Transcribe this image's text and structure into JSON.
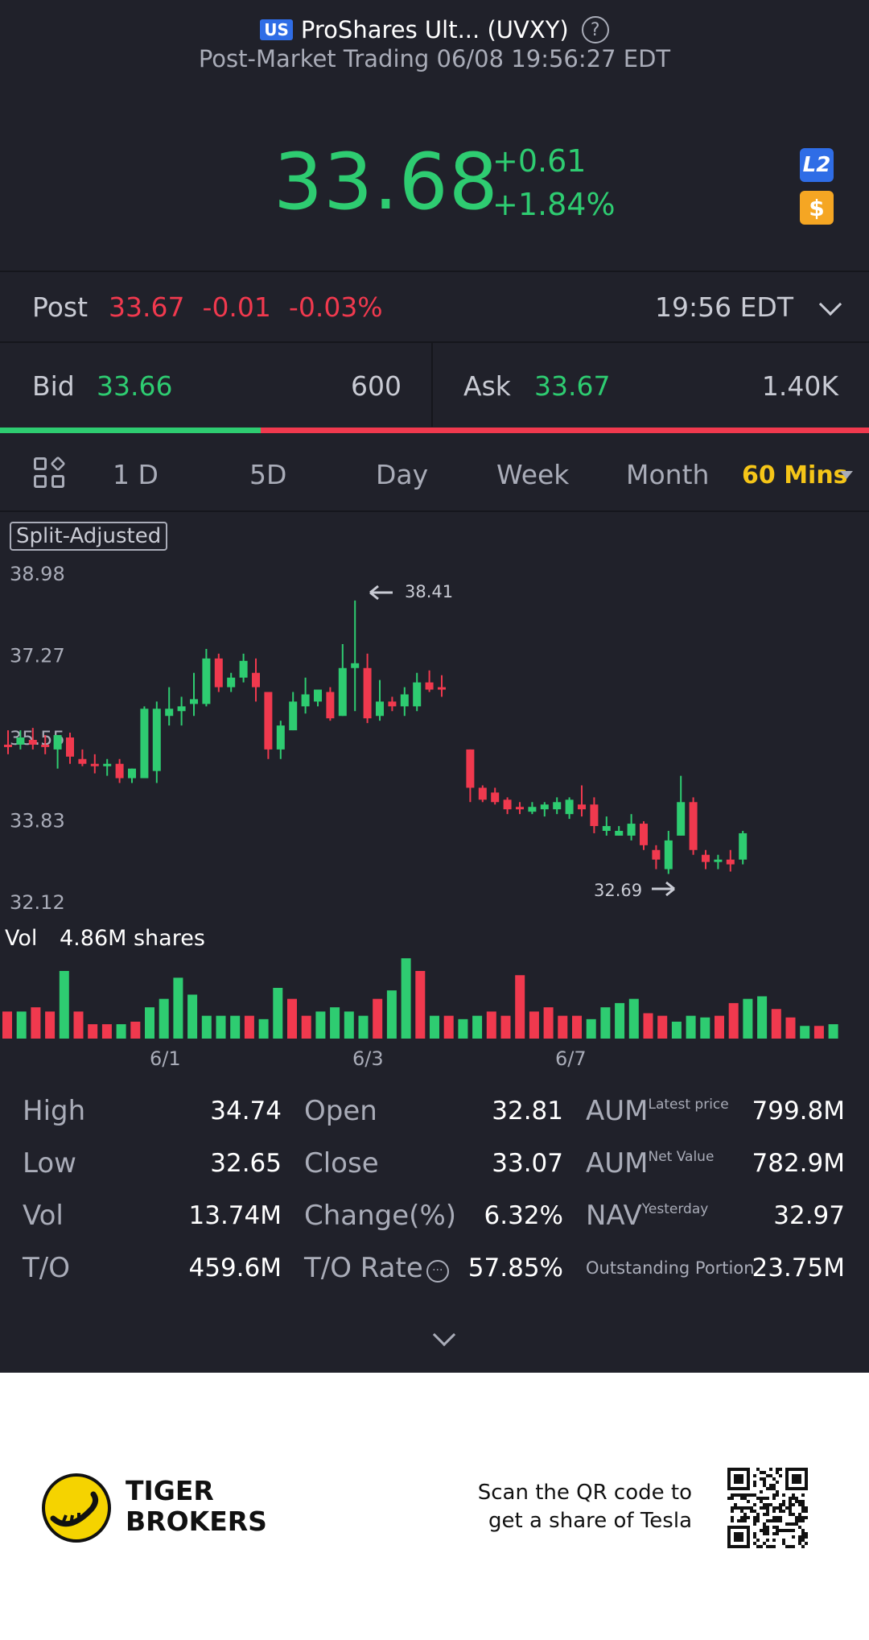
{
  "header": {
    "market_badge": "US",
    "title": "ProShares Ult... (UVXY)",
    "subtitle": "Post-Market Trading 06/08 19:56:27 EDT"
  },
  "quote": {
    "price": "33.68",
    "change": "+0.61",
    "change_pct": "+1.84%",
    "l2_icon": "L2",
    "dollar_icon": "$"
  },
  "post": {
    "label": "Post",
    "price": "33.67",
    "change": "-0.01",
    "change_pct": "-0.03%",
    "time": "19:56 EDT"
  },
  "bid_ask": {
    "bid_label": "Bid",
    "bid_price": "33.66",
    "bid_size": "600",
    "ask_label": "Ask",
    "ask_price": "33.67",
    "ask_size": "1.40K",
    "bid_share": 0.3
  },
  "tabs": [
    {
      "label": "1 D"
    },
    {
      "label": "5D"
    },
    {
      "label": "Day"
    },
    {
      "label": "Week"
    },
    {
      "label": "Month"
    },
    {
      "label": "60 Mins",
      "active": true
    }
  ],
  "chart": {
    "badge": "Split-Adjusted",
    "y_ticks": [
      "38.98",
      "37.27",
      "35.55",
      "33.83",
      "32.12"
    ],
    "max_marker": "38.41",
    "min_marker": "32.69",
    "vol_label": "Vol",
    "vol_value": "4.86M shares",
    "x_ticks": [
      "6/1",
      "6/3",
      "6/7"
    ]
  },
  "chart_data": {
    "type": "candlestick",
    "ylim": [
      32.12,
      38.98
    ],
    "x_ticks": [
      "6/1",
      "6/3",
      "6/7"
    ],
    "candles": [
      {
        "o": 35.4,
        "h": 35.7,
        "l": 35.2,
        "c": 35.35
      },
      {
        "o": 35.4,
        "h": 35.7,
        "l": 35.3,
        "c": 35.55
      },
      {
        "o": 35.5,
        "h": 35.75,
        "l": 35.3,
        "c": 35.4
      },
      {
        "o": 35.4,
        "h": 35.6,
        "l": 35.2,
        "c": 35.35
      },
      {
        "o": 35.3,
        "h": 35.6,
        "l": 34.9,
        "c": 35.6
      },
      {
        "o": 35.55,
        "h": 35.65,
        "l": 35.0,
        "c": 35.15
      },
      {
        "o": 35.1,
        "h": 35.3,
        "l": 34.95,
        "c": 35.0
      },
      {
        "o": 35.0,
        "h": 35.2,
        "l": 34.8,
        "c": 34.95
      },
      {
        "o": 35.0,
        "h": 35.1,
        "l": 34.75,
        "c": 35.0
      },
      {
        "o": 35.0,
        "h": 35.1,
        "l": 34.6,
        "c": 34.7
      },
      {
        "o": 34.7,
        "h": 34.9,
        "l": 34.6,
        "c": 34.9
      },
      {
        "o": 34.7,
        "h": 36.2,
        "l": 34.7,
        "c": 36.15
      },
      {
        "o": 34.85,
        "h": 36.3,
        "l": 34.6,
        "c": 36.15
      },
      {
        "o": 36.0,
        "h": 36.6,
        "l": 35.8,
        "c": 36.15
      },
      {
        "o": 36.1,
        "h": 36.4,
        "l": 35.8,
        "c": 36.2
      },
      {
        "o": 36.25,
        "h": 36.9,
        "l": 36.0,
        "c": 36.35
      },
      {
        "o": 36.25,
        "h": 37.4,
        "l": 36.2,
        "c": 37.2
      },
      {
        "o": 37.2,
        "h": 37.3,
        "l": 36.5,
        "c": 36.6
      },
      {
        "o": 36.6,
        "h": 36.9,
        "l": 36.5,
        "c": 36.8
      },
      {
        "o": 36.8,
        "h": 37.3,
        "l": 36.7,
        "c": 37.15
      },
      {
        "o": 36.9,
        "h": 37.2,
        "l": 36.3,
        "c": 36.6
      },
      {
        "o": 36.5,
        "h": 36.5,
        "l": 35.1,
        "c": 35.3
      },
      {
        "o": 35.3,
        "h": 35.9,
        "l": 35.1,
        "c": 35.8
      },
      {
        "o": 35.7,
        "h": 36.5,
        "l": 35.7,
        "c": 36.3
      },
      {
        "o": 36.2,
        "h": 36.8,
        "l": 36.05,
        "c": 36.45
      },
      {
        "o": 36.3,
        "h": 36.5,
        "l": 36.2,
        "c": 36.55
      },
      {
        "o": 36.5,
        "h": 36.6,
        "l": 35.9,
        "c": 35.95
      },
      {
        "o": 36.0,
        "h": 37.5,
        "l": 36.0,
        "c": 37.0
      },
      {
        "o": 37.0,
        "h": 38.41,
        "l": 36.1,
        "c": 37.1
      },
      {
        "o": 37.0,
        "h": 37.3,
        "l": 35.85,
        "c": 35.95
      },
      {
        "o": 36.0,
        "h": 36.75,
        "l": 35.9,
        "c": 36.3
      },
      {
        "o": 36.3,
        "h": 36.4,
        "l": 36.1,
        "c": 36.2
      },
      {
        "o": 36.2,
        "h": 36.6,
        "l": 36.0,
        "c": 36.45
      },
      {
        "o": 36.2,
        "h": 36.9,
        "l": 36.1,
        "c": 36.7
      },
      {
        "o": 36.7,
        "h": 36.95,
        "l": 36.5,
        "c": 36.55
      },
      {
        "o": 36.6,
        "h": 36.85,
        "l": 36.4,
        "c": 36.55
      },
      {
        "o": 35.3,
        "h": 35.3,
        "l": 34.2,
        "c": 34.5
      },
      {
        "o": 34.5,
        "h": 34.55,
        "l": 34.2,
        "c": 34.25
      },
      {
        "o": 34.4,
        "h": 34.5,
        "l": 34.15,
        "c": 34.2
      },
      {
        "o": 34.25,
        "h": 34.3,
        "l": 33.95,
        "c": 34.05
      },
      {
        "o": 34.1,
        "h": 34.2,
        "l": 33.95,
        "c": 34.05
      },
      {
        "o": 34.0,
        "h": 34.2,
        "l": 33.95,
        "c": 34.1
      },
      {
        "o": 34.05,
        "h": 34.2,
        "l": 33.9,
        "c": 34.15
      },
      {
        "o": 34.05,
        "h": 34.3,
        "l": 33.95,
        "c": 34.2
      },
      {
        "o": 33.95,
        "h": 34.3,
        "l": 33.85,
        "c": 34.25
      },
      {
        "o": 34.15,
        "h": 34.55,
        "l": 33.9,
        "c": 34.05
      },
      {
        "o": 34.15,
        "h": 34.3,
        "l": 33.55,
        "c": 33.7
      },
      {
        "o": 33.6,
        "h": 33.9,
        "l": 33.5,
        "c": 33.7
      },
      {
        "o": 33.5,
        "h": 33.7,
        "l": 33.5,
        "c": 33.6
      },
      {
        "o": 33.5,
        "h": 33.95,
        "l": 33.4,
        "c": 33.75
      },
      {
        "o": 33.75,
        "h": 33.8,
        "l": 33.2,
        "c": 33.3
      },
      {
        "o": 33.2,
        "h": 33.3,
        "l": 32.8,
        "c": 33.0
      },
      {
        "o": 32.8,
        "h": 33.6,
        "l": 32.7,
        "c": 33.4
      },
      {
        "o": 33.5,
        "h": 34.75,
        "l": 33.5,
        "c": 34.2
      },
      {
        "o": 34.2,
        "h": 34.3,
        "l": 33.1,
        "c": 33.2
      },
      {
        "o": 33.1,
        "h": 33.2,
        "l": 32.8,
        "c": 32.95
      },
      {
        "o": 33.0,
        "h": 33.1,
        "l": 32.8,
        "c": 33.0
      },
      {
        "o": 33.0,
        "h": 33.2,
        "l": 32.75,
        "c": 32.9
      },
      {
        "o": 33.0,
        "h": 33.6,
        "l": 32.9,
        "c": 33.55
      }
    ],
    "volume_scale_max": 100,
    "volumes": [
      32,
      32,
      37,
      32,
      80,
      32,
      17,
      17,
      17,
      20,
      37,
      47,
      72,
      52,
      27,
      27,
      27,
      27,
      23,
      60,
      47,
      27,
      32,
      37,
      32,
      27,
      47,
      57,
      95,
      80,
      27,
      27,
      23,
      27,
      32,
      27,
      75,
      32,
      37,
      27,
      27,
      23,
      37,
      42,
      47,
      30,
      27,
      20,
      27,
      25,
      27,
      42,
      47,
      50,
      35,
      25,
      15,
      15,
      17
    ]
  },
  "stats": {
    "high_label": "High",
    "high": "34.74",
    "low_label": "Low",
    "low": "32.65",
    "vol_label": "Vol",
    "vol": "13.74M",
    "to_label": "T/O",
    "to": "459.6M",
    "open_label": "Open",
    "open": "32.81",
    "close_label": "Close",
    "close": "33.07",
    "chgpct_label": "Change(%)",
    "chgpct": "6.32%",
    "torate_label": "T/O Rate",
    "torate": "57.85%",
    "aum1_label": "AUM",
    "aum1_sup": "Latest price",
    "aum1": "799.8M",
    "aum2_label": "AUM",
    "aum2_sup": "Net Value",
    "aum2": "782.9M",
    "nav_label": "NAV",
    "nav_sup": "Yesterday",
    "nav": "32.97",
    "outstanding_label": "Outstanding Portion",
    "outstanding": "23.75M"
  },
  "footer": {
    "brand_line1": "TIGER",
    "brand_line2": "BROKERS",
    "scan_line1": "Scan the QR code to",
    "scan_line2": "get a share of Tesla"
  },
  "colors": {
    "up": "#2ecc71",
    "down": "#f0394e",
    "accent": "#f5c518",
    "background": "#20212a"
  }
}
